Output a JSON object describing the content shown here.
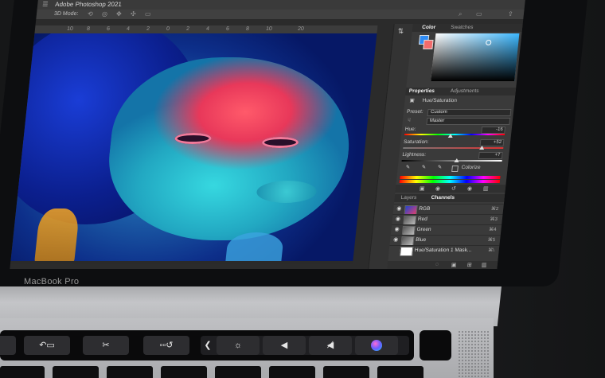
{
  "app": {
    "title": "Adobe Photoshop 2021",
    "mode_label": "3D Mode:"
  },
  "ruler": {
    "ticks": [
      "10",
      "8",
      "6",
      "4",
      "2",
      "0",
      "2",
      "4",
      "6",
      "8",
      "10",
      "20"
    ]
  },
  "color_panel": {
    "tabs": [
      "Color",
      "Swatches"
    ],
    "foreground": "#2f8cf5",
    "background": "#f36b6b"
  },
  "properties_panel": {
    "tabs": [
      "Properties",
      "Adjustments"
    ],
    "adjustment_title": "Hue/Saturation",
    "preset_label": "Preset:",
    "preset_value": "Custom",
    "channel_value": "Master",
    "hue_label": "Hue:",
    "hue_value": "-16",
    "saturation_label": "Saturation:",
    "saturation_value": "+52",
    "lightness_label": "Lightness:",
    "lightness_value": "+7",
    "colorize_label": "Colorize"
  },
  "layers_panel": {
    "tabs": [
      "Layers",
      "Channels"
    ],
    "rows": [
      {
        "name": "RGB",
        "shortcut": "⌘2"
      },
      {
        "name": "Red",
        "shortcut": "⌘3"
      },
      {
        "name": "Green",
        "shortcut": "⌘4"
      },
      {
        "name": "Blue",
        "shortcut": "⌘5"
      },
      {
        "name": "Hue/Saturation 1 Mask...",
        "shortcut": "⌘\\"
      }
    ]
  },
  "device": {
    "model": "MacBook Pro"
  }
}
